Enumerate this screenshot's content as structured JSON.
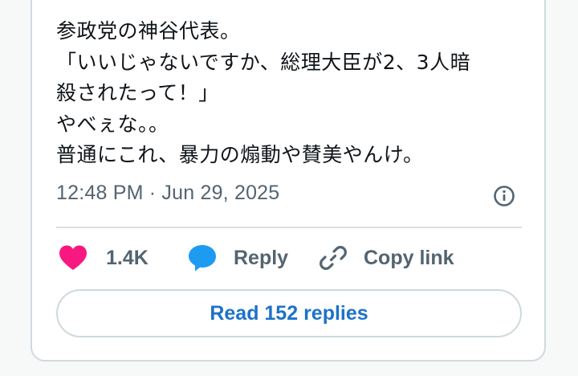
{
  "tweet": {
    "lines": [
      "参政党の神谷代表。",
      "「いいじゃないですか、総理大臣が2、3人暗",
      "殺されたって！」",
      "やべぇな。。",
      "普通にこれ、暴力の煽動や賛美やんけ。"
    ],
    "timestamp": "12:48 PM · Jun 29, 2025"
  },
  "actions": {
    "like_count": "1.4K",
    "reply_label": "Reply",
    "copy_link_label": "Copy link"
  },
  "read_replies_label": "Read 152 replies",
  "icons": {
    "info": "info-icon",
    "heart": "heart-icon",
    "reply": "speech-bubble-icon",
    "link": "link-icon"
  },
  "colors": {
    "heart": "#f91880",
    "reply_bubble": "#1d9bf0",
    "text_secondary": "#536471",
    "link_blue": "#1d72c9",
    "border": "#cfd9de"
  }
}
